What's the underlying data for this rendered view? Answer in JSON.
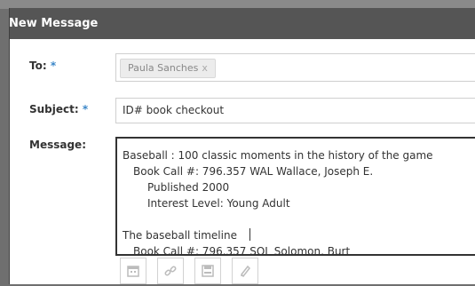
{
  "dialog": {
    "title": "New Message"
  },
  "form": {
    "to_label": "To:",
    "subject_label": "Subject:",
    "message_label": "Message:",
    "required_mark": "*",
    "recipient": "Paula Sanches",
    "recipient_remove": "x",
    "subject_value": "ID# book checkout",
    "message_lines": [
      "Baseball : 100 classic moments in the history of the game",
      "Book   Call #: 796.357 WAL Wallace, Joseph E.",
      "Published 2000",
      "Interest Level: Young Adult",
      "",
      "The baseball timeline",
      "Book   Call #: 796.357 SOL Solomon, Burt"
    ]
  },
  "toolbar": {
    "icons": [
      "calendar-icon",
      "link-icon",
      "save-icon",
      "pen-icon"
    ]
  }
}
